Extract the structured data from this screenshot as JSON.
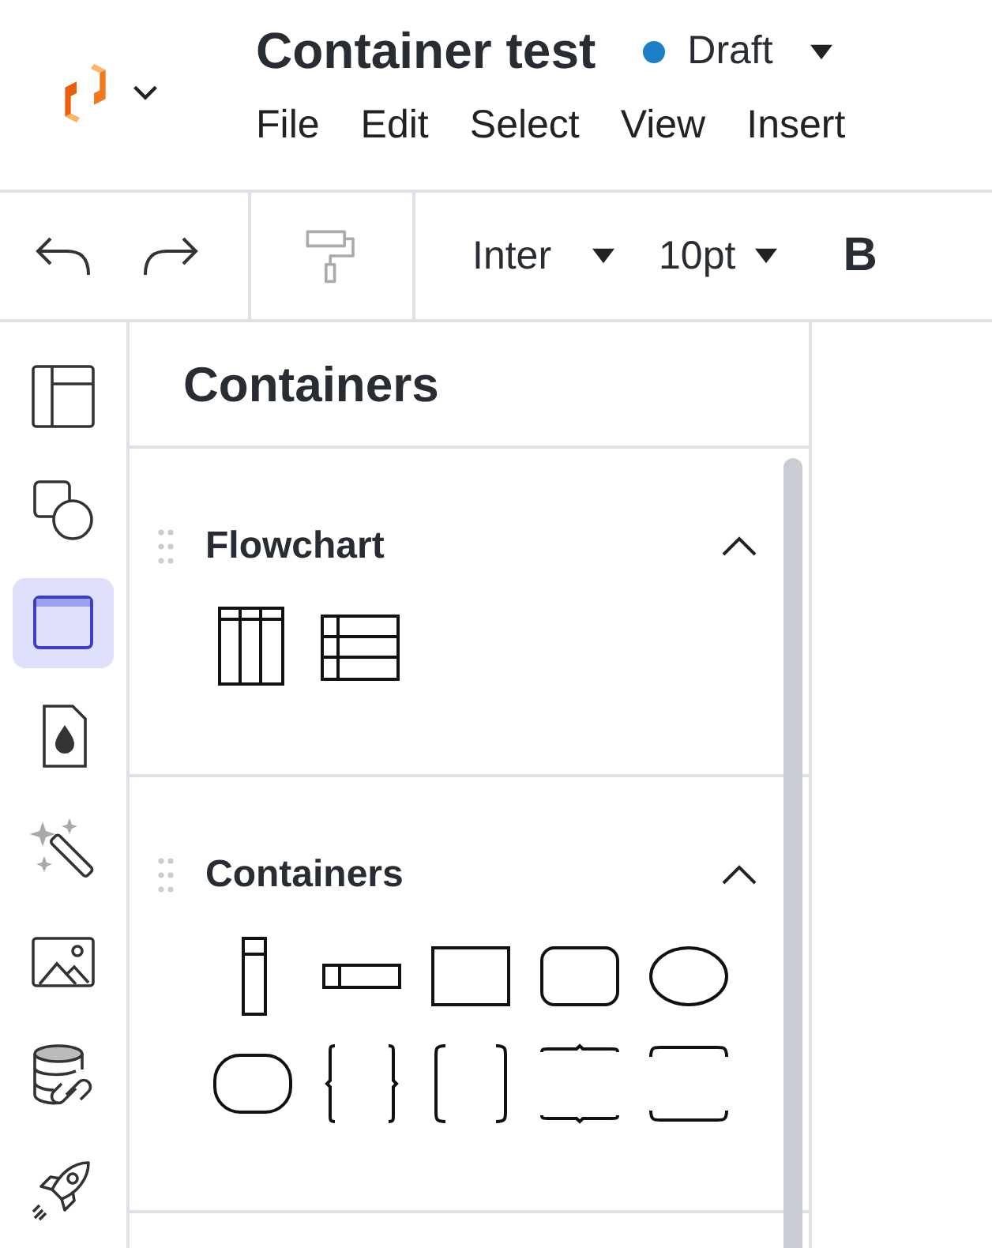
{
  "header": {
    "title": "Container test",
    "status": {
      "label": "Draft",
      "color": "#1a7fc4"
    },
    "menu": [
      "File",
      "Edit",
      "Select",
      "View",
      "Insert"
    ]
  },
  "toolbar": {
    "font": "Inter",
    "size": "10pt",
    "bold": "B"
  },
  "rail": [
    {
      "kind": "layout",
      "selected": false
    },
    {
      "kind": "shapes",
      "selected": false
    },
    {
      "kind": "container",
      "selected": true
    },
    {
      "kind": "drop-doc",
      "selected": false
    },
    {
      "kind": "wand",
      "selected": false
    },
    {
      "kind": "image",
      "selected": false
    },
    {
      "kind": "data-link",
      "selected": false
    },
    {
      "kind": "rocket",
      "selected": false
    }
  ],
  "panel": {
    "title": "Containers",
    "sections": [
      {
        "title": "Flowchart",
        "expanded": true,
        "shapes": [
          {
            "kind": "lanes-vertical"
          },
          {
            "kind": "lanes-horizontal"
          }
        ]
      },
      {
        "title": "Containers",
        "expanded": true,
        "shapes": [
          {
            "kind": "pool-vertical"
          },
          {
            "kind": "pool-horizontal"
          },
          {
            "kind": "rectangle"
          },
          {
            "kind": "rounded"
          },
          {
            "kind": "ellipse"
          },
          {
            "kind": "pill"
          },
          {
            "kind": "braces"
          },
          {
            "kind": "brackets"
          },
          {
            "kind": "brace-horizontal"
          },
          {
            "kind": "bracket-horizontal"
          }
        ]
      }
    ]
  }
}
